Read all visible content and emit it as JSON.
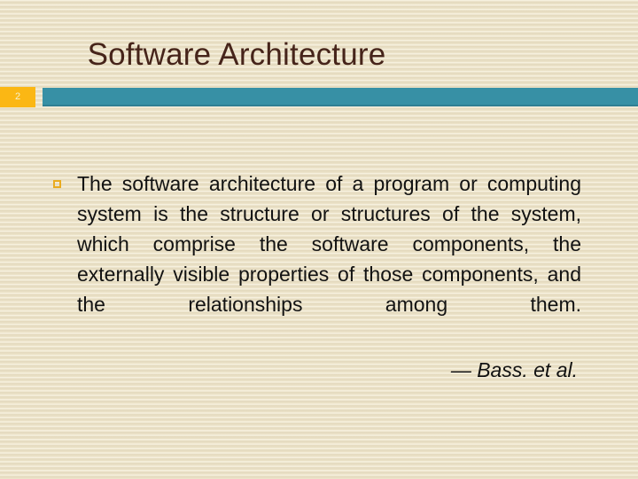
{
  "slide": {
    "title": "Software Architecture",
    "number": "2",
    "bullets": [
      {
        "marker": "hollow-square",
        "text": "The software architecture of a program or computing system is the structure or structures of the system, which comprise the software components, the externally visible properties of those components, and the relationships among them."
      }
    ],
    "attribution": "— Bass. et al.",
    "colors": {
      "background": "#eae1c7",
      "title_text": "#46241a",
      "divider_bar": "#3790a5",
      "slide_number_box": "#fbb714",
      "slide_number_text": "#f7f2cf",
      "bullet_marker": "#e9ab20",
      "body_text": "#121212"
    }
  }
}
